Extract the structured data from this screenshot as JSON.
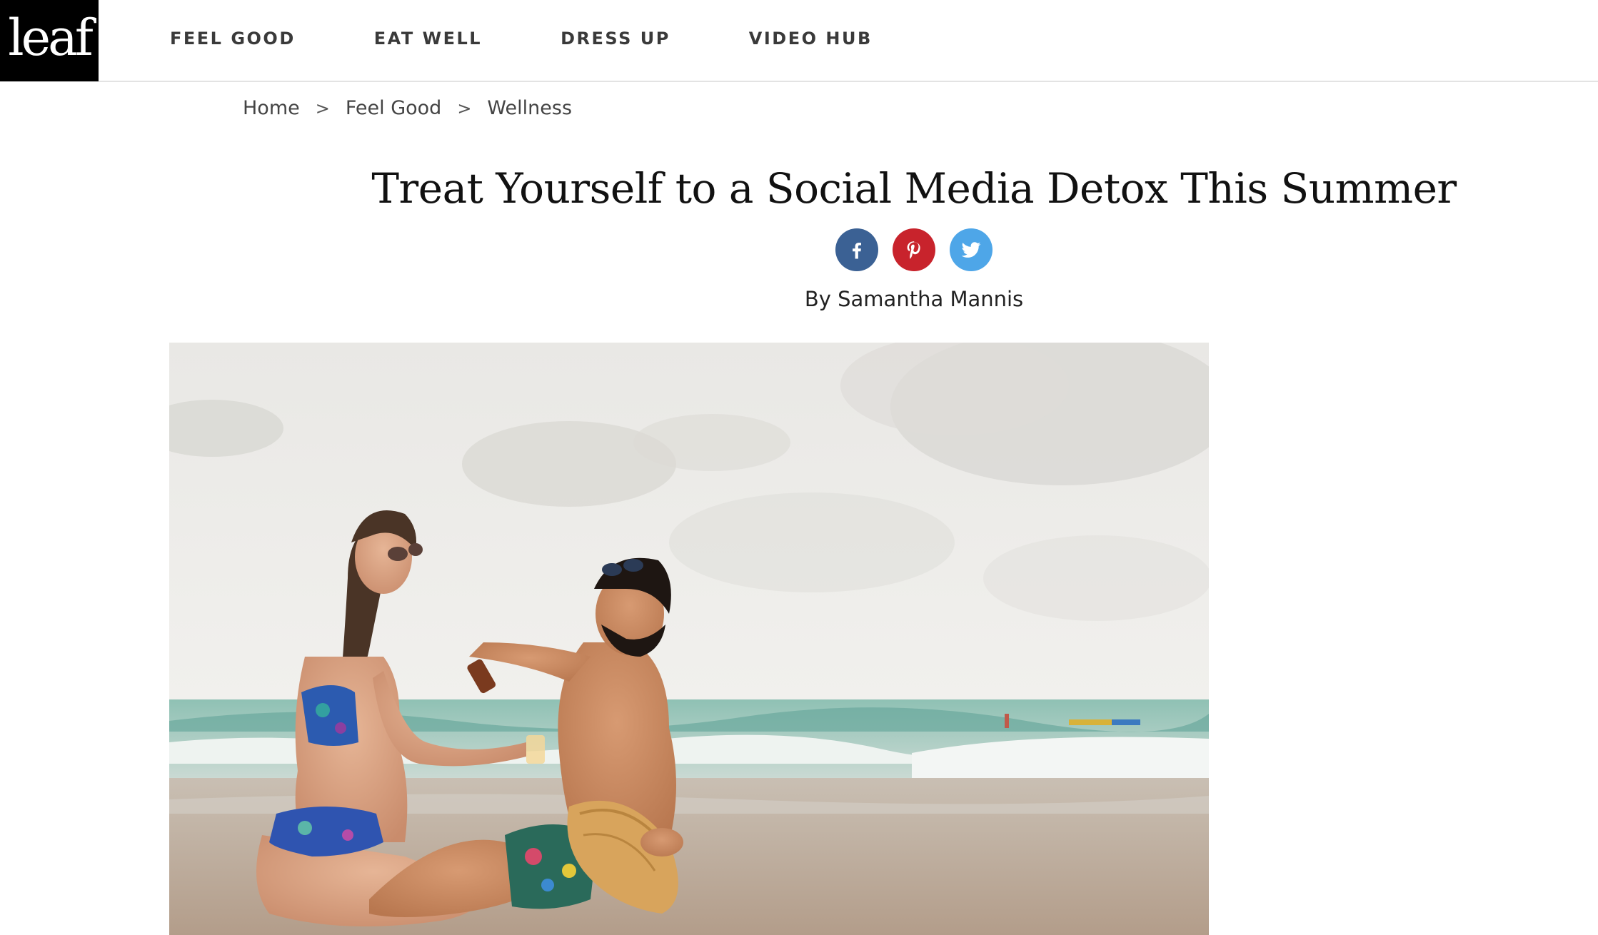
{
  "site": {
    "logo_text": "leaf"
  },
  "nav": {
    "items": [
      {
        "label": "FEEL GOOD"
      },
      {
        "label": "EAT WELL"
      },
      {
        "label": "DRESS UP"
      },
      {
        "label": "VIDEO HUB"
      }
    ]
  },
  "breadcrumb": {
    "items": [
      {
        "label": "Home"
      },
      {
        "label": "Feel Good"
      },
      {
        "label": "Wellness"
      }
    ],
    "separator": ">"
  },
  "article": {
    "title": "Treat Yourself to a Social Media Detox This Summer",
    "byline": "By Samantha Mannis",
    "share": [
      {
        "network": "facebook",
        "icon": "facebook-icon",
        "color": "#3b6194"
      },
      {
        "network": "pinterest",
        "icon": "pinterest-icon",
        "color": "#c8232c"
      },
      {
        "network": "twitter",
        "icon": "twitter-icon",
        "color": "#4ea6e8"
      }
    ]
  },
  "colors": {
    "header_border": "#e3e3e3",
    "logo_bg": "#000000",
    "nav_text": "#3a3a3a"
  }
}
